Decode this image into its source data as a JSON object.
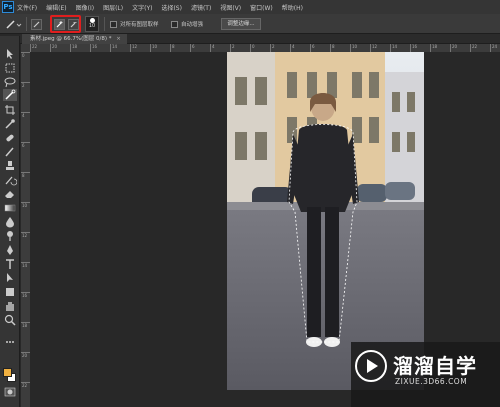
{
  "app": {
    "logo": "Ps"
  },
  "menu": [
    "文件(F)",
    "编辑(E)",
    "图像(I)",
    "图层(L)",
    "文字(Y)",
    "选择(S)",
    "滤镜(T)",
    "视图(V)",
    "窗口(W)",
    "帮助(H)"
  ],
  "options": {
    "brush_size": "10",
    "sample_all_layers": "对所有图层取样",
    "auto_enhance": "自动增强",
    "refine_edge": "调整边缘..."
  },
  "document": {
    "tab_title": "素材.jpeg @ 66.7%(图层 0/8) *",
    "close_glyph": "×"
  },
  "rulers": {
    "h_ticks": [
      "22",
      "20",
      "18",
      "16",
      "14",
      "12",
      "10",
      "8",
      "6",
      "4",
      "2",
      "0",
      "2",
      "4",
      "6",
      "8",
      "10",
      "12",
      "14",
      "16",
      "18",
      "20",
      "22",
      "24"
    ],
    "v_ticks": [
      "0",
      "2",
      "4",
      "6",
      "8",
      "10",
      "12",
      "14",
      "16",
      "18",
      "20",
      "22"
    ]
  },
  "colors": {
    "foreground": "#f0b040",
    "background": "#ffffff",
    "highlight": "#e01e1e"
  },
  "watermark": {
    "title": "溜溜自学",
    "url": "ZIXUE.3D66.COM"
  },
  "icons": [
    "brush-icon",
    "quick-selection-icon",
    "move-icon",
    "marquee-icon",
    "lasso-icon",
    "crop-icon",
    "eyedropper-icon",
    "healing-icon",
    "brush-tool-icon",
    "stamp-icon",
    "history-brush-icon",
    "eraser-icon",
    "gradient-icon",
    "blur-icon",
    "dodge-icon",
    "pen-icon",
    "type-icon",
    "path-select-icon",
    "shape-icon",
    "hand-icon",
    "zoom-icon"
  ]
}
